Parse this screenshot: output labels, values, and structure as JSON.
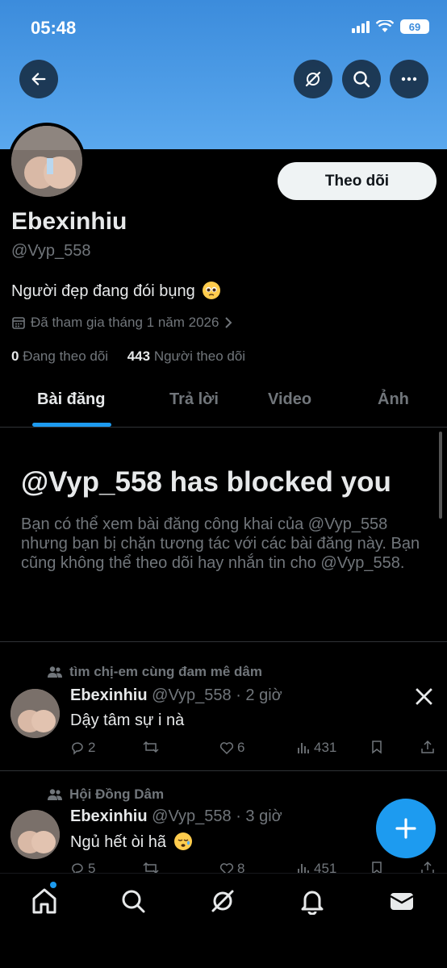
{
  "status_bar": {
    "time": "05:48",
    "battery": "69"
  },
  "profile": {
    "name": "Ebexinhiu",
    "handle": "@Vyp_558",
    "bio": "Người đẹp đang đói bụng",
    "joined": "Đã tham gia tháng 1 năm 2026",
    "following_count": "0",
    "following_label": "Đang theo dõi",
    "followers_count": "443",
    "followers_label": "Người theo dõi",
    "follow_button": "Theo dõi"
  },
  "tabs": [
    {
      "label": "Bài đăng",
      "active": true
    },
    {
      "label": "Trả lời",
      "active": false
    },
    {
      "label": "Video",
      "active": false
    },
    {
      "label": "Ảnh",
      "active": false
    }
  ],
  "blocked": {
    "title": "@Vyp_558 has blocked you",
    "description": "Bạn có thể xem bài đăng công khai của @Vyp_558 nhưng bạn bị chặn tương tác với các bài đăng này. Bạn cũng không thể theo dõi hay nhắn tin cho @Vyp_558."
  },
  "posts": [
    {
      "community": "tìm chị-em cùng đam mê dâm",
      "name": "Ebexinhiu",
      "meta": "@Vyp_558 · 2 giờ",
      "text": "Dậy tâm sự i nà",
      "replies": "2",
      "reposts": "",
      "likes": "6",
      "views": "431"
    },
    {
      "community": "Hội Đồng Dâm",
      "name": "Ebexinhiu",
      "meta": "@Vyp_558 · 3 giờ",
      "text": "Ngủ hết òi hã",
      "replies": "5",
      "reposts": "",
      "likes": "8",
      "views": "451"
    }
  ],
  "icons": {
    "back": "back-arrow-icon",
    "grok": "grok-icon",
    "search": "search-icon",
    "more": "more-icon",
    "compose": "plus-icon",
    "nav": [
      "home-icon",
      "search-icon",
      "grok-icon",
      "notifications-icon",
      "messages-icon"
    ]
  },
  "colors": {
    "accent": "#1d9bf0",
    "banner": "#4a9be6",
    "background": "#000000"
  }
}
